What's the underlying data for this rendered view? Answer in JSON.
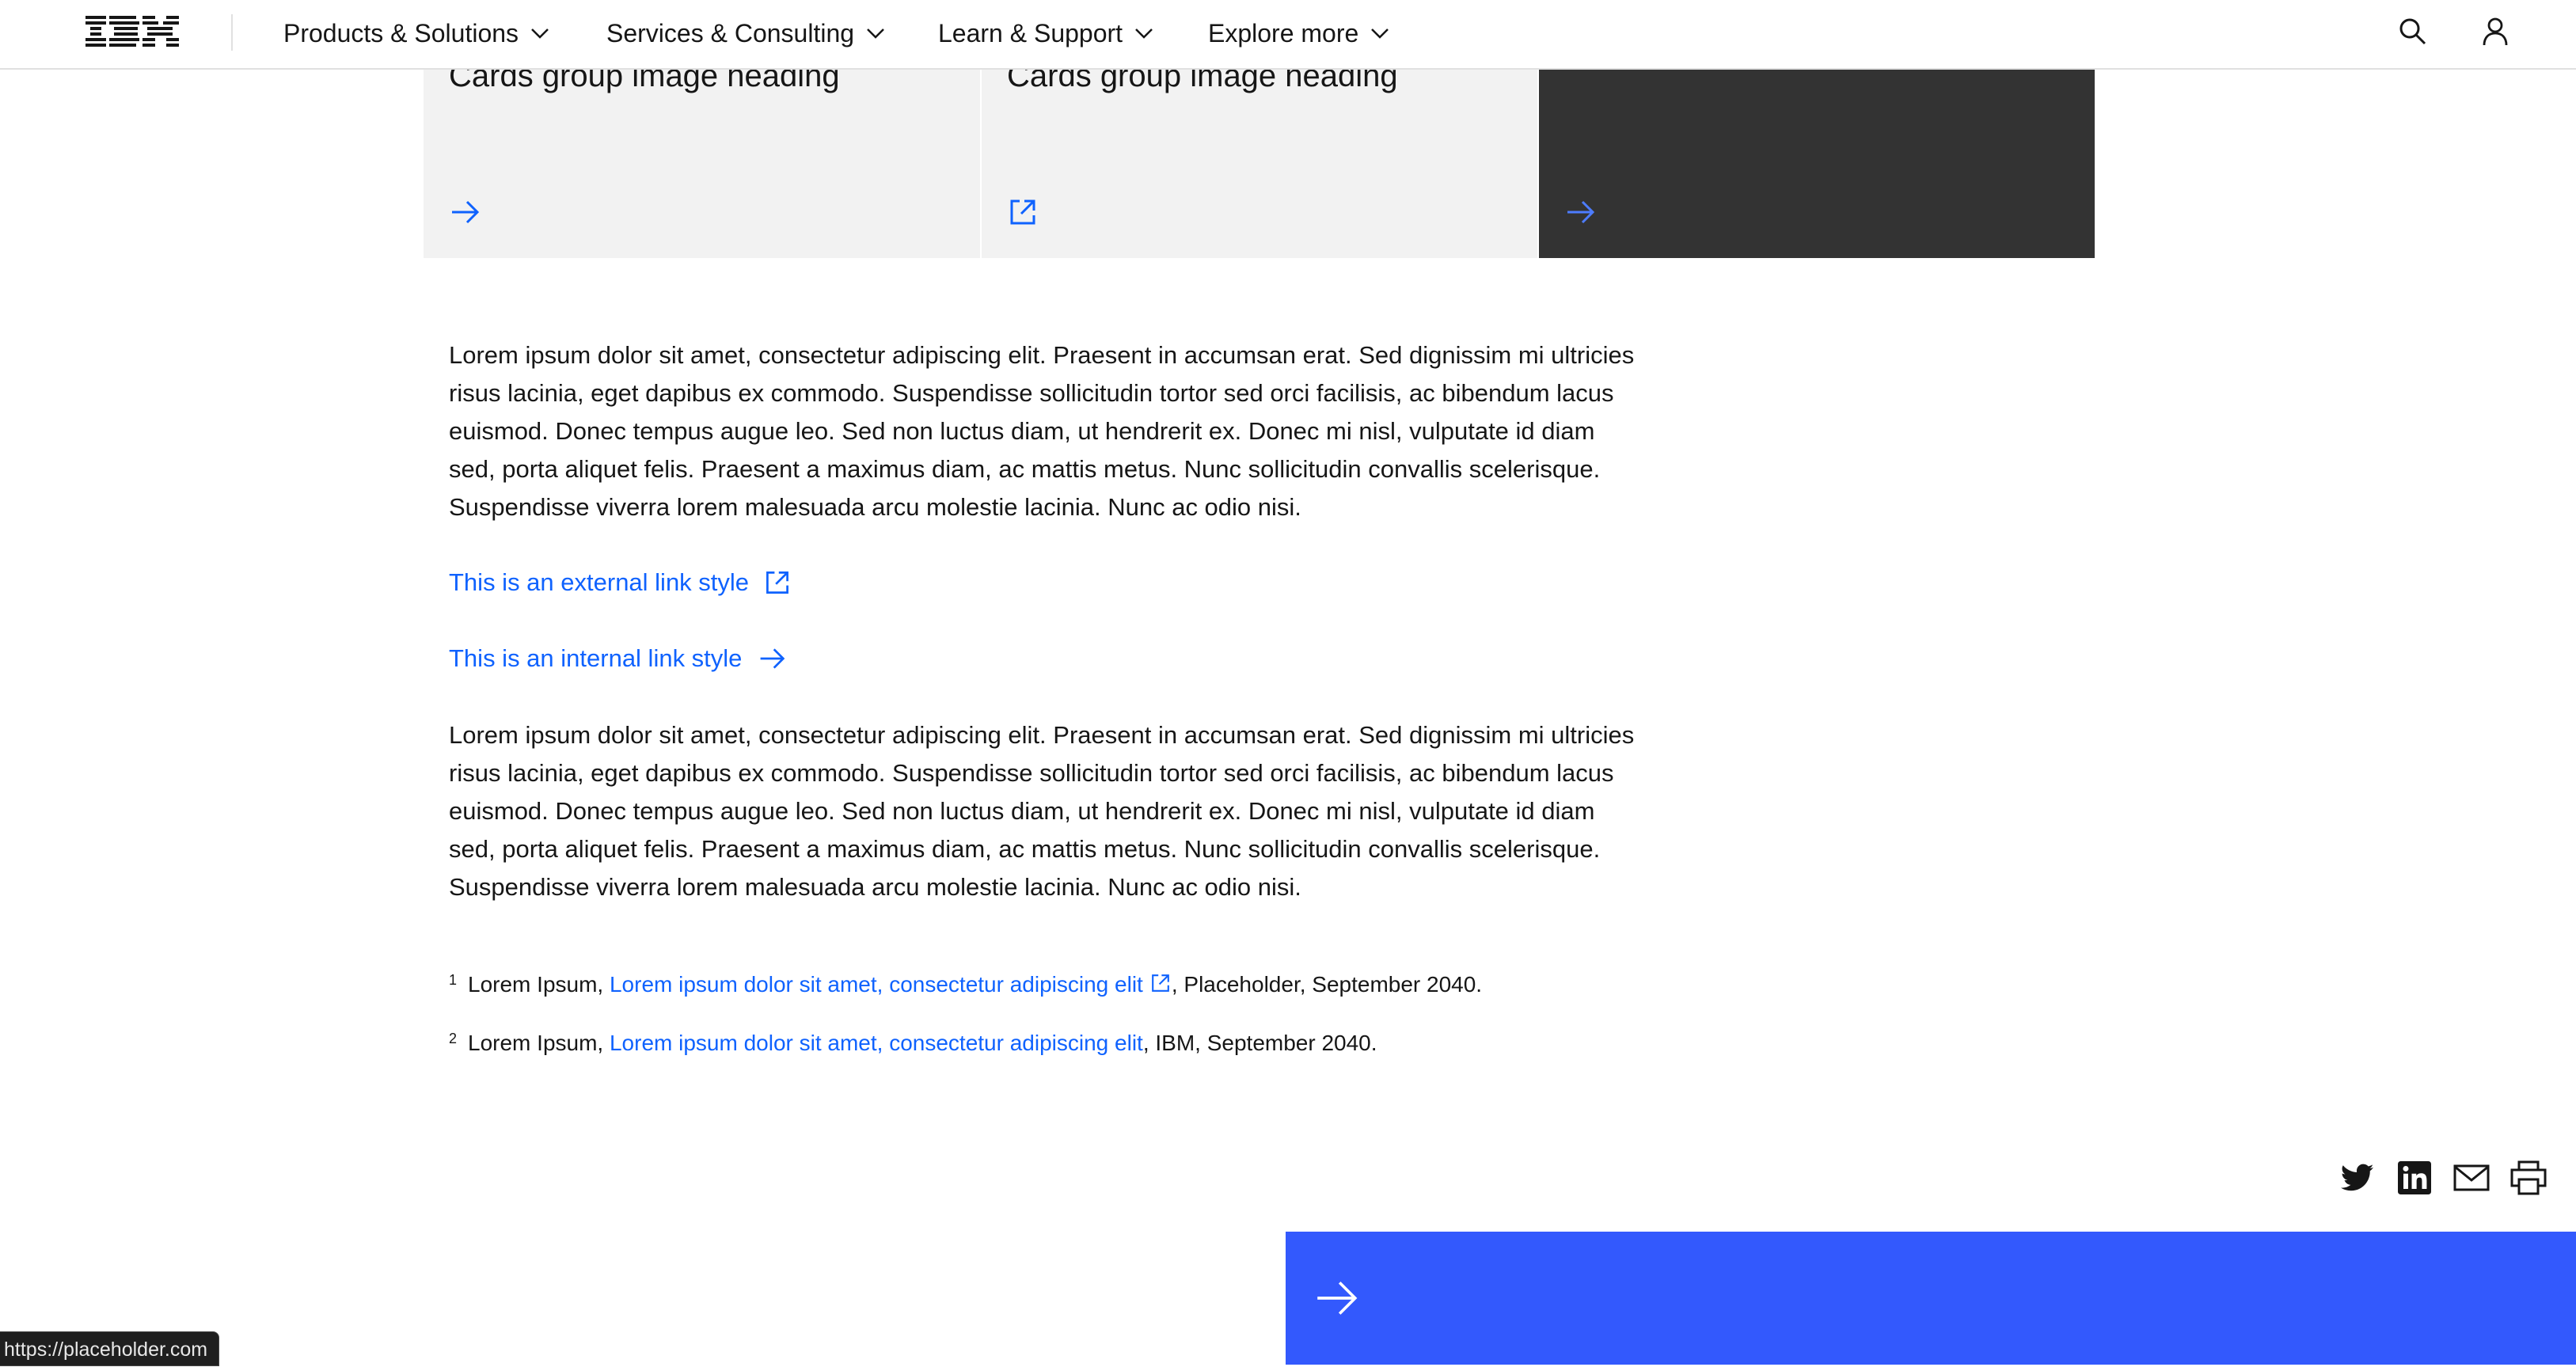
{
  "nav": {
    "logo_text": "IBM",
    "items": [
      {
        "label": "Products & Solutions"
      },
      {
        "label": "Services & Consulting"
      },
      {
        "label": "Learn & Support"
      },
      {
        "label": "Explore more"
      }
    ],
    "icons": [
      "search-icon",
      "user-icon"
    ]
  },
  "cards": [
    {
      "heading": "Cards group image heading",
      "icon": "arrow-right-icon",
      "theme": "light"
    },
    {
      "heading": "Cards group image heading",
      "icon": "launch-icon",
      "theme": "light"
    },
    {
      "heading": "",
      "icon": "arrow-right-icon",
      "theme": "dark"
    }
  ],
  "content": {
    "paragraph_1": "Lorem ipsum dolor sit amet, consectetur adipiscing elit. Praesent in accumsan erat. Sed dignissim mi ultricies risus lacinia, eget dapibus ex commodo. Suspendisse sollicitudin tortor sed orci facilisis, ac bibendum lacus euismod. Donec tempus augue leo. Sed non luctus diam, ut hendrerit ex. Donec mi nisl, vulputate id diam sed, porta aliquet felis. Praesent a maximus diam, ac mattis metus. Nunc sollicitudin convallis scelerisque. Suspendisse viverra lorem malesuada arcu molestie lacinia. Nunc ac odio nisi.",
    "external_link": "This is an external link style",
    "internal_link": "This is an internal link style",
    "paragraph_2": "Lorem ipsum dolor sit amet, consectetur adipiscing elit. Praesent in accumsan erat. Sed dignissim mi ultricies risus lacinia, eget dapibus ex commodo. Suspendisse sollicitudin tortor sed orci facilisis, ac bibendum lacus euismod. Donec tempus augue leo. Sed non luctus diam, ut hendrerit ex. Donec mi nisl, vulputate id diam sed, porta aliquet felis. Praesent a maximus diam, ac mattis metus. Nunc sollicitudin convallis scelerisque. Suspendisse viverra lorem malesuada arcu molestie lacinia. Nunc ac odio nisi."
  },
  "footnotes": [
    {
      "num": "1",
      "prefix": "Lorem Ipsum, ",
      "link": "Lorem ipsum dolor sit amet, consectetur adipiscing elit",
      "suffix": ", Placeholder, September 2040."
    },
    {
      "num": "2",
      "prefix": "Lorem Ipsum, ",
      "link": "Lorem ipsum dolor sit amet, consectetur adipiscing elit",
      "suffix": ", IBM, September 2040."
    }
  ],
  "share": [
    "twitter-icon",
    "linkedin-icon",
    "email-icon",
    "print-icon"
  ],
  "cta": {
    "icon": "arrow-right-icon"
  },
  "status_bar": {
    "url": "https://placeholder.com"
  },
  "colors": {
    "link": "#0f62fe",
    "cta_background": "#3359fd",
    "card_light": "#f2f2f2",
    "card_dark": "#333333",
    "text": "#161616"
  }
}
